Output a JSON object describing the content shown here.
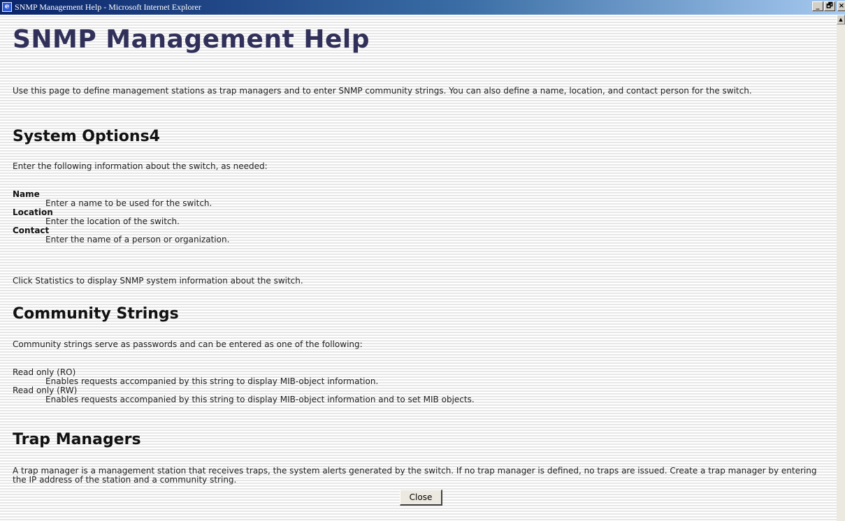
{
  "window": {
    "title": "SNMP Management Help - Microsoft Internet Explorer",
    "icon": "ie-page-icon",
    "controls": {
      "minimize": "_",
      "maximize": "🗗",
      "close": "×"
    }
  },
  "page": {
    "title": "SNMP Management Help",
    "intro": "Use this page to define management stations as trap managers and to enter SNMP community strings. You can also define a name, location, and contact person for the switch.",
    "system_options": {
      "heading": "System Options4",
      "lead": "Enter the following information about the switch, as needed:",
      "items": [
        {
          "term": "Name",
          "desc": "Enter a name to be used for the switch."
        },
        {
          "term": "Location",
          "desc": "Enter the location of the switch."
        },
        {
          "term": "Contact",
          "desc": "Enter the name of a person or organization."
        }
      ],
      "note": "Click Statistics to display SNMP system information about the switch."
    },
    "community_strings": {
      "heading": "Community Strings",
      "lead": "Community strings serve as passwords and can be entered as one of the following:",
      "items": [
        {
          "term": "Read only (RO)",
          "desc": "Enables requests accompanied by this string to display MIB-object information."
        },
        {
          "term": "Read only (RW)",
          "desc": "Enables requests accompanied by this string to display MIB-object information and to set MIB objects."
        }
      ]
    },
    "trap_managers": {
      "heading": "Trap Managers",
      "body": "A trap manager is a management station that receives traps, the system alerts generated by the switch. If no trap manager is defined, no traps are issued. Create a trap manager by entering the IP address of the station and a community string."
    },
    "close_label": "Close"
  },
  "colors": {
    "title_heading": "#30305a",
    "titlebar_start": "#0a246a",
    "titlebar_end": "#a6caf0"
  }
}
